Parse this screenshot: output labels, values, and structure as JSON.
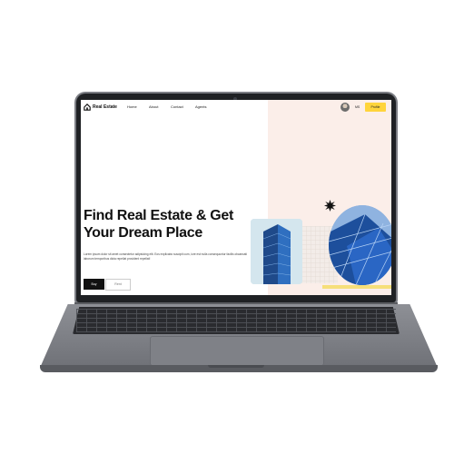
{
  "nav": {
    "brand": "Real Estate",
    "links": [
      "Home",
      "About",
      "Contact",
      "Agents"
    ],
    "user_name": "MS",
    "profile_label": "Profile",
    "logo_icon": "house-icon"
  },
  "hero": {
    "headline_line1": "Find Real Estate & Get",
    "headline_line2": "Your Dream Place",
    "description": "Lorem ipsum dolor sit amet consectetur adipisicing elit. Eos explicabo suscipit cum, iure est nulla consequuntur facilis obcaecati laborum temporibus dicta repellat provident repellat!",
    "buy_label": "Buy",
    "rent_label": "Rent"
  },
  "colors": {
    "accent": "#ffd43b",
    "hero_bg": "#fbeee9",
    "text": "#111111"
  }
}
